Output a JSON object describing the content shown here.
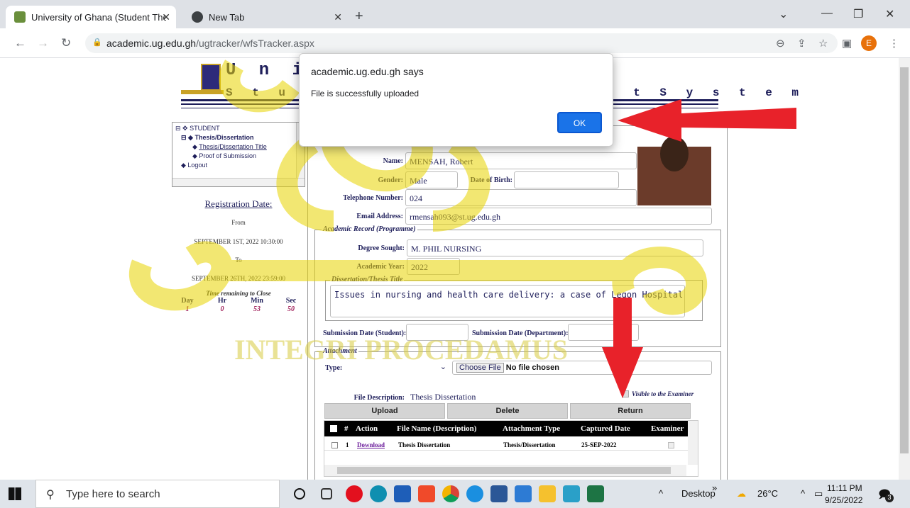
{
  "browser": {
    "tabs": [
      {
        "title": "University of Ghana (Student The",
        "active": true
      },
      {
        "title": "New Tab",
        "active": false
      }
    ],
    "url_host": "academic.ug.edu.gh",
    "url_path": "/ugtracker/wfsTracker.aspx",
    "profile_initial": "E"
  },
  "header": {
    "title": "U n i v",
    "subtitle_left": "S t u d e n",
    "subtitle_right": "n t   S y s t e m"
  },
  "tree": {
    "root": "STUDENT",
    "group": "Thesis/Dissertation",
    "items": [
      "Thesis/Dissertation Title",
      "Proof of Submission"
    ],
    "logout": "Logout"
  },
  "registration": {
    "heading": "Registration Date:",
    "from_label": "From",
    "from_value": "SEPTEMBER 1ST, 2022 10:30:00",
    "to_label": "To",
    "to_value": "SEPTEMBER 26TH, 2022 23:59:00",
    "remaining_label": "Time remaining to Close",
    "units": [
      "Day",
      "Hr",
      "Min",
      "Sec"
    ],
    "values": [
      "1",
      "0",
      "53",
      "50"
    ]
  },
  "student": {
    "name_label": "Name:",
    "name_value": "MENSAH, Robert",
    "gender_label": "Gender:",
    "gender_value": "Male",
    "dob_label": "Date of Birth:",
    "dob_value": "",
    "phone_label": "Telephone Number:",
    "phone_value": "024",
    "email_label": "Email Address:",
    "email_value": "rmensah093@st.ug.edu.gh"
  },
  "academic": {
    "legend": "Academic Record (Programme)",
    "degree_label": "Degree Sought:",
    "degree_value": "M. PHIL NURSING",
    "year_label": "Academic Year:",
    "year_value": "2022",
    "thesis_legend": "Dissertation/Thesis Title",
    "thesis_value": "Issues in nursing and health care delivery: a case of Legon Hospital",
    "sub_student_label": "Submission Date (Student):",
    "sub_dept_label": "Submission Date (Department):"
  },
  "attachment": {
    "legend": "Attachment",
    "type_label": "Type:",
    "choose_file": "Choose File",
    "no_file": "No file chosen",
    "desc_label": "File Description:",
    "desc_value": "Thesis Dissertation",
    "visible_label": "Visible to the Examiner",
    "buttons": {
      "upload": "Upload",
      "delete": "Delete",
      "return": "Return"
    },
    "columns": [
      "#",
      "Action",
      "File Name (Description)",
      "Attachment Type",
      "Captured Date",
      "Examiner"
    ],
    "rows": [
      {
        "num": "1",
        "action": "Download",
        "file_name": "Thesis Dissertation",
        "type": "Thesis/Dissertation",
        "date": "25-SEP-2022"
      }
    ]
  },
  "dialog": {
    "title": "academic.ug.edu.gh says",
    "message": "File is successfully uploaded",
    "ok": "OK"
  },
  "watermark": {
    "motto": "INTEGRI PROCEDAMUS"
  },
  "taskbar": {
    "search_placeholder": "Type here to search",
    "desktop_label": "Desktop",
    "weather": "26°C",
    "time": "11:11 PM",
    "date": "9/25/2022",
    "notifications": "3"
  },
  "colors": {
    "accent": "#1e1e5a",
    "arrow": "#e8222a",
    "watermark": "#e8d400"
  }
}
